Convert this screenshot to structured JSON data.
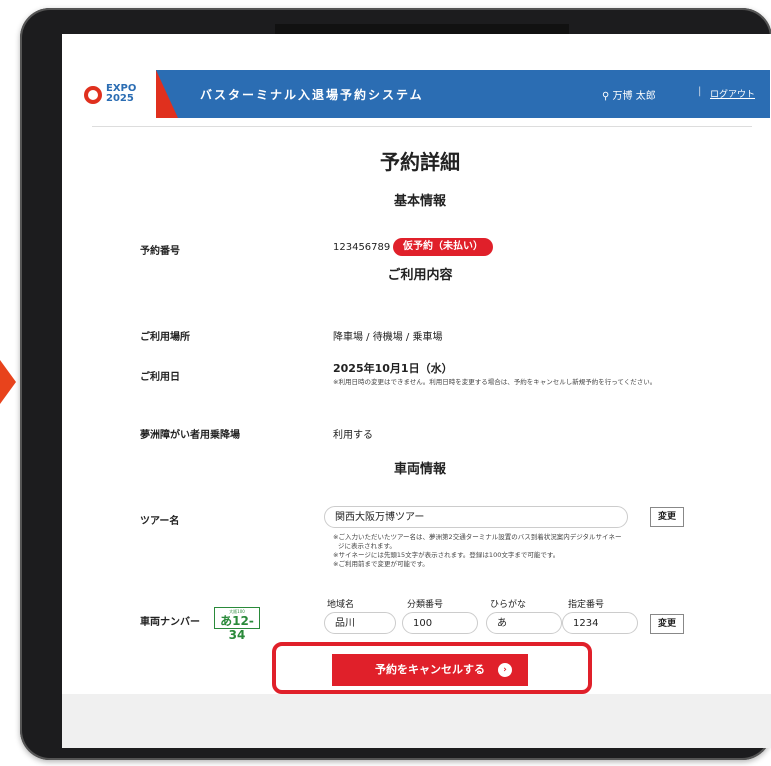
{
  "header": {
    "logo_text": "EXPO 2025",
    "system_title": "バスターミナル入退場予約システム",
    "user_name": "万博 太郎",
    "logout_label": "ログアウト"
  },
  "page": {
    "title": "予約詳細",
    "section_basic": "基本情報",
    "section_usage": "ご利用内容",
    "section_vehicle": "車両情報"
  },
  "basic": {
    "reservation_no_label": "予約番号",
    "reservation_no": "123456789",
    "status_badge": "仮予約（未払い）"
  },
  "usage": {
    "place_label": "ご利用場所",
    "place_value": "降車場 / 待機場 / 乗車場",
    "date_label": "ご利用日",
    "date_value": "2025年10月1日（水）",
    "date_note": "※利用日時の変更はできません。利用日時を変更する場合は、予約をキャンセルし新規予約を行ってください。",
    "accessible_label": "夢洲障がい者用乗降場",
    "accessible_value": "利用する"
  },
  "vehicle": {
    "tour_label": "ツアー名",
    "tour_value": "関西大阪万博ツアー",
    "tour_change": "変更",
    "tour_note_1": "※ご入力いただいたツアー名は、夢洲第2交通ターミナル設置のバス到着状況案内デジタルサイネー",
    "tour_note_2": "ジに表示されます。",
    "tour_note_3": "※サイネージには先頭15文字が表示されます。登録は100文字まで可能です。",
    "tour_note_4": "※ご利用前まで変更が可能です。",
    "plate_label": "車両ナンバー",
    "plate_top": "大阪100",
    "plate_num": "あ12-34",
    "region_label": "地域名",
    "region_value": "品川",
    "class_label": "分類番号",
    "class_value": "100",
    "hiragana_label": "ひらがな",
    "hiragana_value": "あ",
    "number_label": "指定番号",
    "number_value": "1234",
    "plate_change": "変更"
  },
  "actions": {
    "cancel_label": "予約をキャンセルする"
  },
  "colors": {
    "header_blue": "#2b6db3",
    "accent_red": "#e0202a",
    "plate_green": "#2a8a3a"
  }
}
